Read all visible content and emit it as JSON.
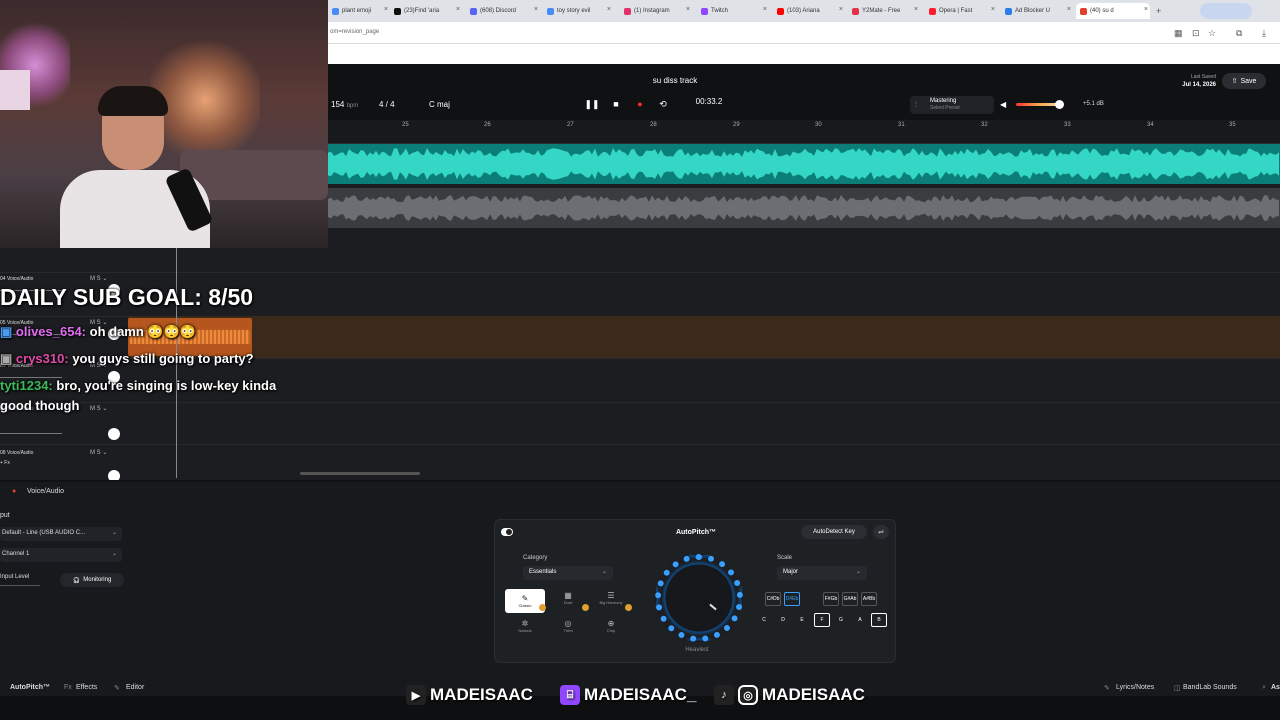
{
  "browser": {
    "tabs": [
      {
        "label": "plant emoji",
        "color": "#4a8cf7"
      },
      {
        "label": "(23)Find 'aria",
        "color": "#111111"
      },
      {
        "label": "(608) Discord",
        "color": "#5865f2"
      },
      {
        "label": "toy story evil",
        "color": "#4a8cf7"
      },
      {
        "label": "(1) Instagram",
        "color": "#e1306c"
      },
      {
        "label": "Twitch",
        "color": "#9146ff"
      },
      {
        "label": "(103) Ariana",
        "color": "#ff0000"
      },
      {
        "label": "Y2Mate - Free",
        "color": "#e5324a"
      },
      {
        "label": "Opera | Fast",
        "color": "#ff1b2d"
      },
      {
        "label": "Ad Blocker U",
        "color": "#2b7de9"
      },
      {
        "label": "(40) su d",
        "color": "#e0402f"
      }
    ],
    "url": "om=revision_page"
  },
  "daw": {
    "song_title": "su diss track",
    "bpm_value": "154",
    "bpm_unit": "bpm",
    "time_signature": "4 / 4",
    "key": "C maj",
    "timecode": "00:33.2",
    "mastering_title": "Mastering",
    "mastering_sub": "Select Preset",
    "volume_db": "+5.1 dB",
    "last_saved_label": "Last Saved",
    "last_saved_date": "Jul 14, 2026",
    "save_label": "Save",
    "ruler": [
      "25",
      "26",
      "27",
      "28",
      "29",
      "30",
      "31",
      "32",
      "33",
      "34",
      "35"
    ]
  },
  "tracks": [
    {
      "name": "04 Voice/Audio",
      "mute": "M",
      "solo": "S"
    },
    {
      "name": "05 Voice/Audio",
      "mute": "M",
      "solo": "S"
    },
    {
      "name": "06 Voice/Audio",
      "mute": "M",
      "solo": "S"
    },
    {
      "name": "07 Voice/Audio",
      "mute": "M",
      "solo": "S"
    },
    {
      "name": "08 Voice/Audio",
      "mute": "M",
      "solo": "S"
    }
  ],
  "track_fx": "+ Fx",
  "overlay": {
    "goal": "DAILY SUB GOAL: 8/50",
    "chat": [
      {
        "user": "olives_654:",
        "msg": "oh damn 😳😳😳",
        "color": "#e06cf0"
      },
      {
        "user": "crys310:",
        "msg": "you guys still going to party?",
        "color": "#e04aa8"
      },
      {
        "user": "tyti1234:",
        "msg": "bro, you're singing is low-key kinda",
        "color": "#3cba5a"
      },
      {
        "user": "",
        "msg": "good though",
        "color": "#ffffff"
      }
    ]
  },
  "inspector": {
    "track_label": "Voice/Audio",
    "input_label": "put",
    "input_device": "Default - Line (USB AUDIO C...",
    "channel": "Channel 1",
    "input_level": "Input Level",
    "monitoring": "Monitoring"
  },
  "autopitch": {
    "title": "AutoPitch™",
    "autodetect": "AutoDetect Key",
    "category_label": "Category",
    "category_value": "Essentials",
    "scale_label": "Scale",
    "scale_value": "Major",
    "styles": [
      "Classic",
      "Duet",
      "Big Harmony",
      "Natural",
      "Third",
      "Chip"
    ],
    "intensity_label": "Heaviest",
    "sharp_keys": [
      "C#Db",
      "D#Eb",
      "F#Gb",
      "G#Ab",
      "A#Bb"
    ],
    "natural_keys": [
      "C",
      "D",
      "E",
      "F",
      "G",
      "A",
      "B"
    ],
    "accent_color": "#3aa0ff"
  },
  "bottom_bar": {
    "autopitch": "AutoPitch™",
    "effects": "Effects",
    "editor": "Editor",
    "lyrics": "Lyrics/Notes",
    "sounds": "BandLab Sounds",
    "as": "As"
  },
  "socials": [
    "MADEISAAC",
    "MADEISAAC_",
    "MADEISAAC"
  ]
}
